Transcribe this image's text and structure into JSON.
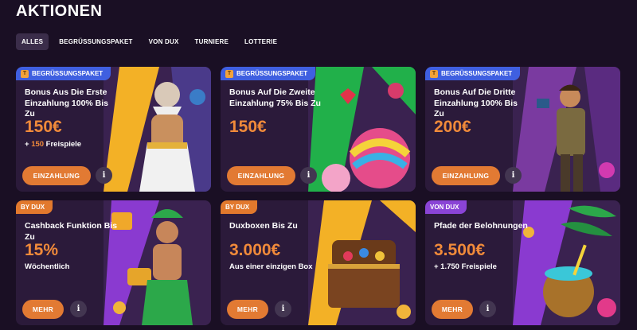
{
  "page": {
    "title": "AKTIONEN"
  },
  "tabs": [
    {
      "label": "ALLES"
    },
    {
      "label": "BEGRÜSSUNGSPAKET"
    },
    {
      "label": "VON DUX"
    },
    {
      "label": "TURNIERE"
    },
    {
      "label": "LOTTERIE"
    }
  ],
  "cards": [
    {
      "badge": "BEGRÜSSUNGSPAKET",
      "badge_icon": "T",
      "title": "Bonus Aus Die Erste Einzahlung 100% Bis Zu",
      "amount": "150€",
      "sub_prefix": "+ ",
      "sub_highlight": "150",
      "sub_suffix": " Freispiele",
      "button": "EINZAHLUNG",
      "info": "i"
    },
    {
      "badge": "BEGRÜSSUNGSPAKET",
      "badge_icon": "T",
      "title": "Bonus Auf Die Zweite Einzahlung 75% Bis Zu",
      "amount": "150€",
      "button": "EINZAHLUNG",
      "info": "i"
    },
    {
      "badge": "BEGRÜSSUNGSPAKET",
      "badge_icon": "T",
      "title": "Bonus Auf Die Dritte Einzahlung 100% Bis Zu",
      "amount": "200€",
      "button": "EINZAHLUNG",
      "info": "i"
    },
    {
      "badge": "BY DUX",
      "title": "Cashback Funktion Bis Zu",
      "amount": "15%",
      "sub_text": "Wöchentlich",
      "button": "MEHR",
      "info": "i"
    },
    {
      "badge": "BY DUX",
      "title": "Duxboxen Bis Zu",
      "amount": "3.000€",
      "sub_text": "Aus einer einzigen Box",
      "button": "MEHR",
      "info": "i"
    },
    {
      "badge": "VON DUX",
      "title": "Pfade der Belohnungen",
      "amount": "3.500€",
      "sub_text": "+ 1.750 Freispiele",
      "button": "MEHR",
      "info": "i"
    }
  ],
  "colors": {
    "background": "#1a0f24",
    "card": "#2b1a3a",
    "accent": "#f08a3a",
    "button": "#e27a33"
  }
}
